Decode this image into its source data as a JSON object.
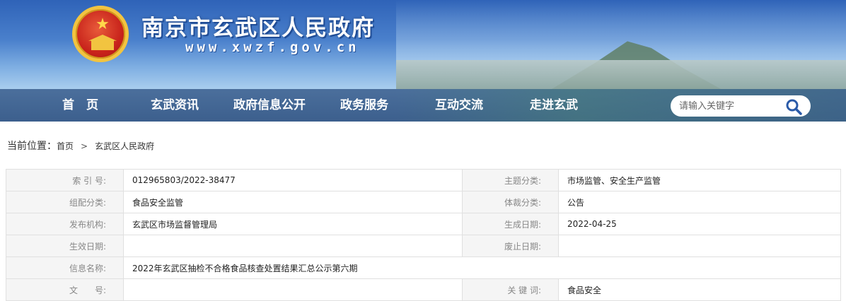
{
  "header": {
    "site_title": "南京市玄武区人民政府",
    "site_url": "www.xwzf.gov.cn"
  },
  "nav": {
    "items": [
      {
        "label": "首　页"
      },
      {
        "label": "玄武资讯"
      },
      {
        "label": "政府信息公开"
      },
      {
        "label": "政务服务"
      },
      {
        "label": "互动交流"
      },
      {
        "label": "走进玄武"
      }
    ],
    "search_placeholder": "请输入关键字"
  },
  "breadcrumb": {
    "label": "当前位置：",
    "home": "首页",
    "separator": ">",
    "current": "玄武区人民政府"
  },
  "meta": {
    "index_label": "索 引 号:",
    "index_value": "012965803/2022-38477",
    "topic_label": "主题分类:",
    "topic_value": "市场监管、安全生产监管",
    "org_cat_label": "组配分类:",
    "org_cat_value": "食品安全监管",
    "genre_label": "体裁分类:",
    "genre_value": "公告",
    "publisher_label": "发布机构:",
    "publisher_value": "玄武区市场监督管理局",
    "created_label": "生成日期:",
    "created_value": "2022-04-25",
    "effective_label": "生效日期:",
    "effective_value": "",
    "abolished_label": "废止日期:",
    "abolished_value": "",
    "name_label": "信息名称:",
    "name_value": "2022年玄武区抽检不合格食品核查处置结果汇总公示第六期",
    "doc_no_label": "文　　号:",
    "doc_no_value": "",
    "keywords_label": "关 键 词:",
    "keywords_value": "食品安全"
  }
}
